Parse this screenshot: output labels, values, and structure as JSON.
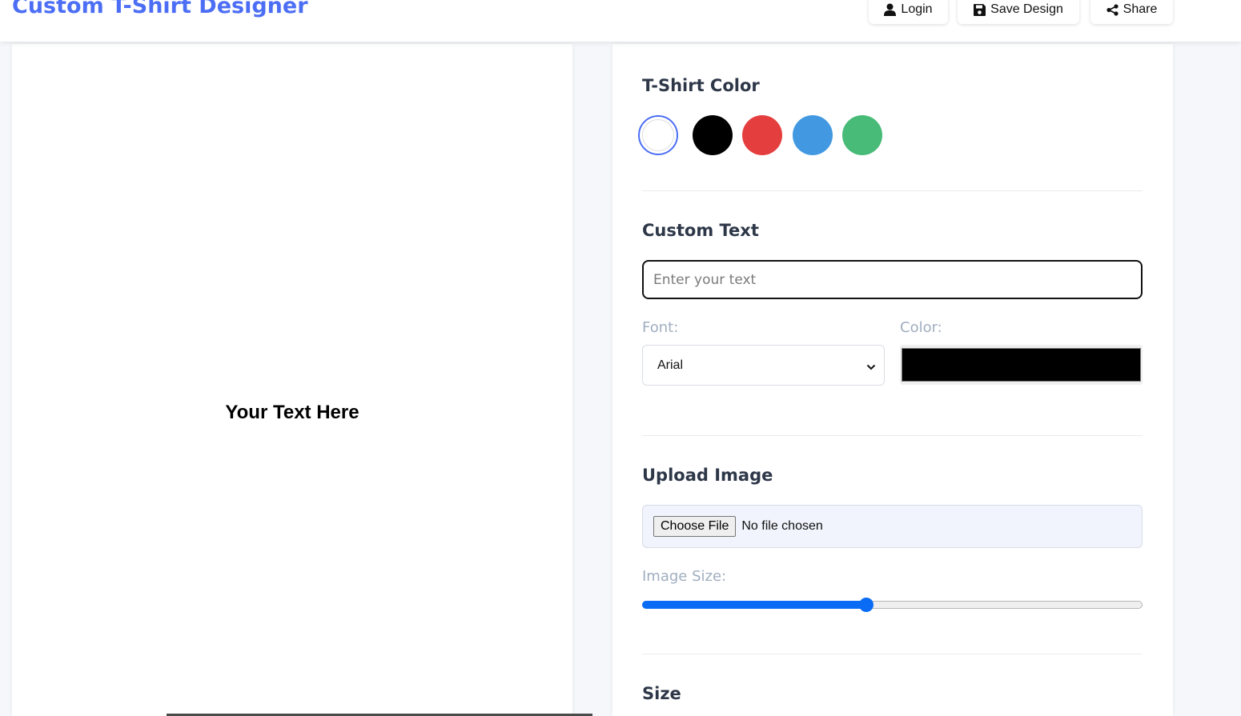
{
  "header": {
    "title": "Custom T-Shirt Designer",
    "buttons": [
      {
        "label": "Login",
        "icon": "user-icon"
      },
      {
        "label": "Save Design",
        "icon": "save-icon"
      },
      {
        "label": "Share",
        "icon": "share-icon"
      }
    ]
  },
  "preview": {
    "text": "Your Text Here"
  },
  "tshirt_color": {
    "title": "T-Shirt Color",
    "options": [
      {
        "name": "white",
        "hex": "#ffffff",
        "selected": true
      },
      {
        "name": "black",
        "hex": "#000000",
        "selected": false
      },
      {
        "name": "red",
        "hex": "#e53e3e",
        "selected": false
      },
      {
        "name": "blue",
        "hex": "#4299e1",
        "selected": false
      },
      {
        "name": "green",
        "hex": "#48bb78",
        "selected": false
      }
    ]
  },
  "custom_text": {
    "title": "Custom Text",
    "placeholder": "Enter your text",
    "value": "",
    "font_label": "Font:",
    "font_value": "Arial",
    "color_label": "Color:",
    "color_value": "#000000"
  },
  "upload_image": {
    "title": "Upload Image",
    "button_label": "Choose File",
    "status": "No file chosen",
    "size_label": "Image Size:",
    "size_fraction": 0.447
  },
  "size": {
    "title": "Size"
  },
  "colors": {
    "accent": "#4c6ef5",
    "slider": "#0a6cf5"
  }
}
